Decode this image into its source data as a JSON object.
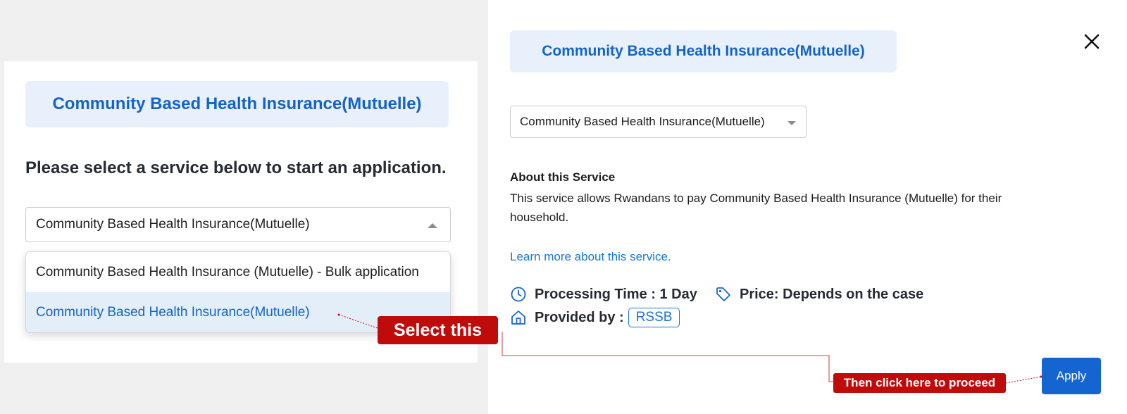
{
  "left": {
    "service_title": "Community Based Health Insurance(Mutuelle)",
    "instruction": "Please select a service below to start an application.",
    "select_value": "Community Based Health Insurance(Mutuelle)",
    "options": [
      "Community Based Health Insurance (Mutuelle) - Bulk application",
      "Community Based Health Insurance(Mutuelle)"
    ],
    "selected_option_index": 1
  },
  "right": {
    "service_title": "Community Based Health Insurance(Mutuelle)",
    "select_value": "Community Based Health Insurance(Mutuelle)",
    "about_heading": "About this Service",
    "about_text": "This service allows Rwandans to pay Community Based Health Insurance (Mutuelle) for their household.",
    "learn_more": "Learn more about this service.",
    "processing_time": "Processing Time : 1 Day",
    "price": "Price: Depends on the case",
    "provided_by_label": "Provided by :",
    "provider": "RSSB",
    "apply_label": "Apply"
  },
  "callouts": {
    "select_this": "Select this",
    "proceed": "Then click here to proceed"
  },
  "icons": {
    "close": "close-icon",
    "clock": "clock-icon",
    "price_tag": "tag-icon",
    "provider": "building-icon"
  },
  "colors": {
    "accent_blue": "#1463c7",
    "chip_background": "#e8f1fb",
    "callout_red": "#c00b0b",
    "apply_button": "#1565d0"
  }
}
